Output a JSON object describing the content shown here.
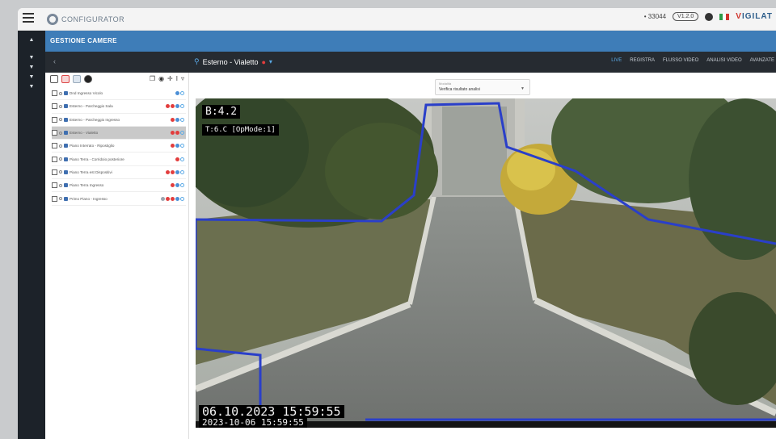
{
  "topbar": {
    "logo_text": "CONFIGURATOR",
    "code": "• 33044",
    "version": "V1.2.0",
    "brand": "IGILAT"
  },
  "rail": {
    "items": [
      "▲",
      "▼",
      "▼",
      "▼",
      "▼"
    ]
  },
  "module": {
    "title": "GESTIONE CAMERE"
  },
  "toolbar": {
    "back": "‹",
    "camera_title": "Esterno - Vialetto",
    "actions": [
      {
        "label": "LIVE",
        "active": true
      },
      {
        "label": "REGISTRA",
        "active": false
      },
      {
        "label": "FLUSSO VIDEO",
        "active": false
      },
      {
        "label": "ANALISI VIDEO",
        "active": false
      },
      {
        "label": "AVANZATE",
        "active": false
      }
    ]
  },
  "list": {
    "cameras": [
      {
        "name": "Dnd Ingresso Vicolo",
        "selected": false,
        "icons": [
          "b",
          "w"
        ]
      },
      {
        "name": "Esterno - Parcheggio Sala",
        "selected": false,
        "icons": [
          "r",
          "r",
          "b",
          "w"
        ]
      },
      {
        "name": "Esterno - Parcheggio Ingresso",
        "selected": false,
        "icons": [
          "r",
          "b",
          "w"
        ]
      },
      {
        "name": "Esterno - Vialetto",
        "selected": true,
        "icons": [
          "r",
          "r",
          "w"
        ]
      },
      {
        "name": "Piano Interrato - Ripostiglio",
        "selected": false,
        "icons": [
          "r",
          "b",
          "w"
        ]
      },
      {
        "name": "Piano Terra - Corridoio posteriore",
        "selected": false,
        "icons": [
          "r",
          "w"
        ]
      },
      {
        "name": "Piano Terra est Dispositivi",
        "selected": false,
        "icons": [
          "r",
          "r",
          "b",
          "w"
        ]
      },
      {
        "name": "Piano Terra Ingresso",
        "selected": false,
        "icons": [
          "r",
          "b",
          "w"
        ]
      },
      {
        "name": "Primo Piano - Ingresso",
        "selected": false,
        "icons": [
          "g",
          "r",
          "r",
          "b",
          "w"
        ]
      }
    ]
  },
  "view": {
    "select_label": "Modalità",
    "select_value": "Verifica risultato analisi",
    "osd_b": "B:4.2",
    "osd_t": "T:6.C [OpMode:1]",
    "osd_datetime": "06.10.2023  15:59:55",
    "osd_datetime2": "2023-10-06  15:59:55"
  },
  "colors": {
    "module_blue": "#3e7db8",
    "toolbar_dark": "#262b31",
    "rail_dark": "#1c2229",
    "zone_line": "#2a3fc9",
    "selected_row": "#c9c9c9"
  }
}
